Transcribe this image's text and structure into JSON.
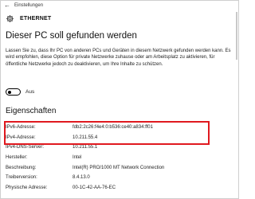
{
  "window": {
    "title": "Einstellungen"
  },
  "header": {
    "title": "ETHERNET",
    "icon": "gear-icon"
  },
  "section1": {
    "heading": "Dieser PC soll gefunden werden",
    "description": "Lassen Sie zu, dass Ihr PC von anderen PCs und Geräten in diesem Netzwerk gefunden werden kann. Es wird empfohlen, diese Option für private Netzwerke zuhause oder am Arbeitsplatz zu aktivieren, für öffentliche Netzwerke jedoch zu deaktivieren, um Ihre Inhalte zu schützen.",
    "toggle_label": "Aus",
    "toggle_state": "off"
  },
  "section2": {
    "heading": "Eigenschaften",
    "rows": [
      {
        "key": "IPv6-Adresse:",
        "value": "fdb2:2c26:f4e4:0:b536:ce40:a834:ff01"
      },
      {
        "key": "IPv4-Adresse:",
        "value": "10.211.55.4"
      },
      {
        "key": "IPv4-DNS-Server:",
        "value": "10.211.55.1"
      },
      {
        "key": "Hersteller:",
        "value": "Intel"
      },
      {
        "key": "Beschreibung:",
        "value": "Intel(R) PRO/1000 MT Network Connection"
      },
      {
        "key": "Treiberversion:",
        "value": "8.4.13.0"
      },
      {
        "key": "Physische Adresse:",
        "value": "00-1C-42-AA-76-EC"
      }
    ]
  },
  "colors": {
    "highlight": "#e0191f",
    "accent": "#000000"
  }
}
